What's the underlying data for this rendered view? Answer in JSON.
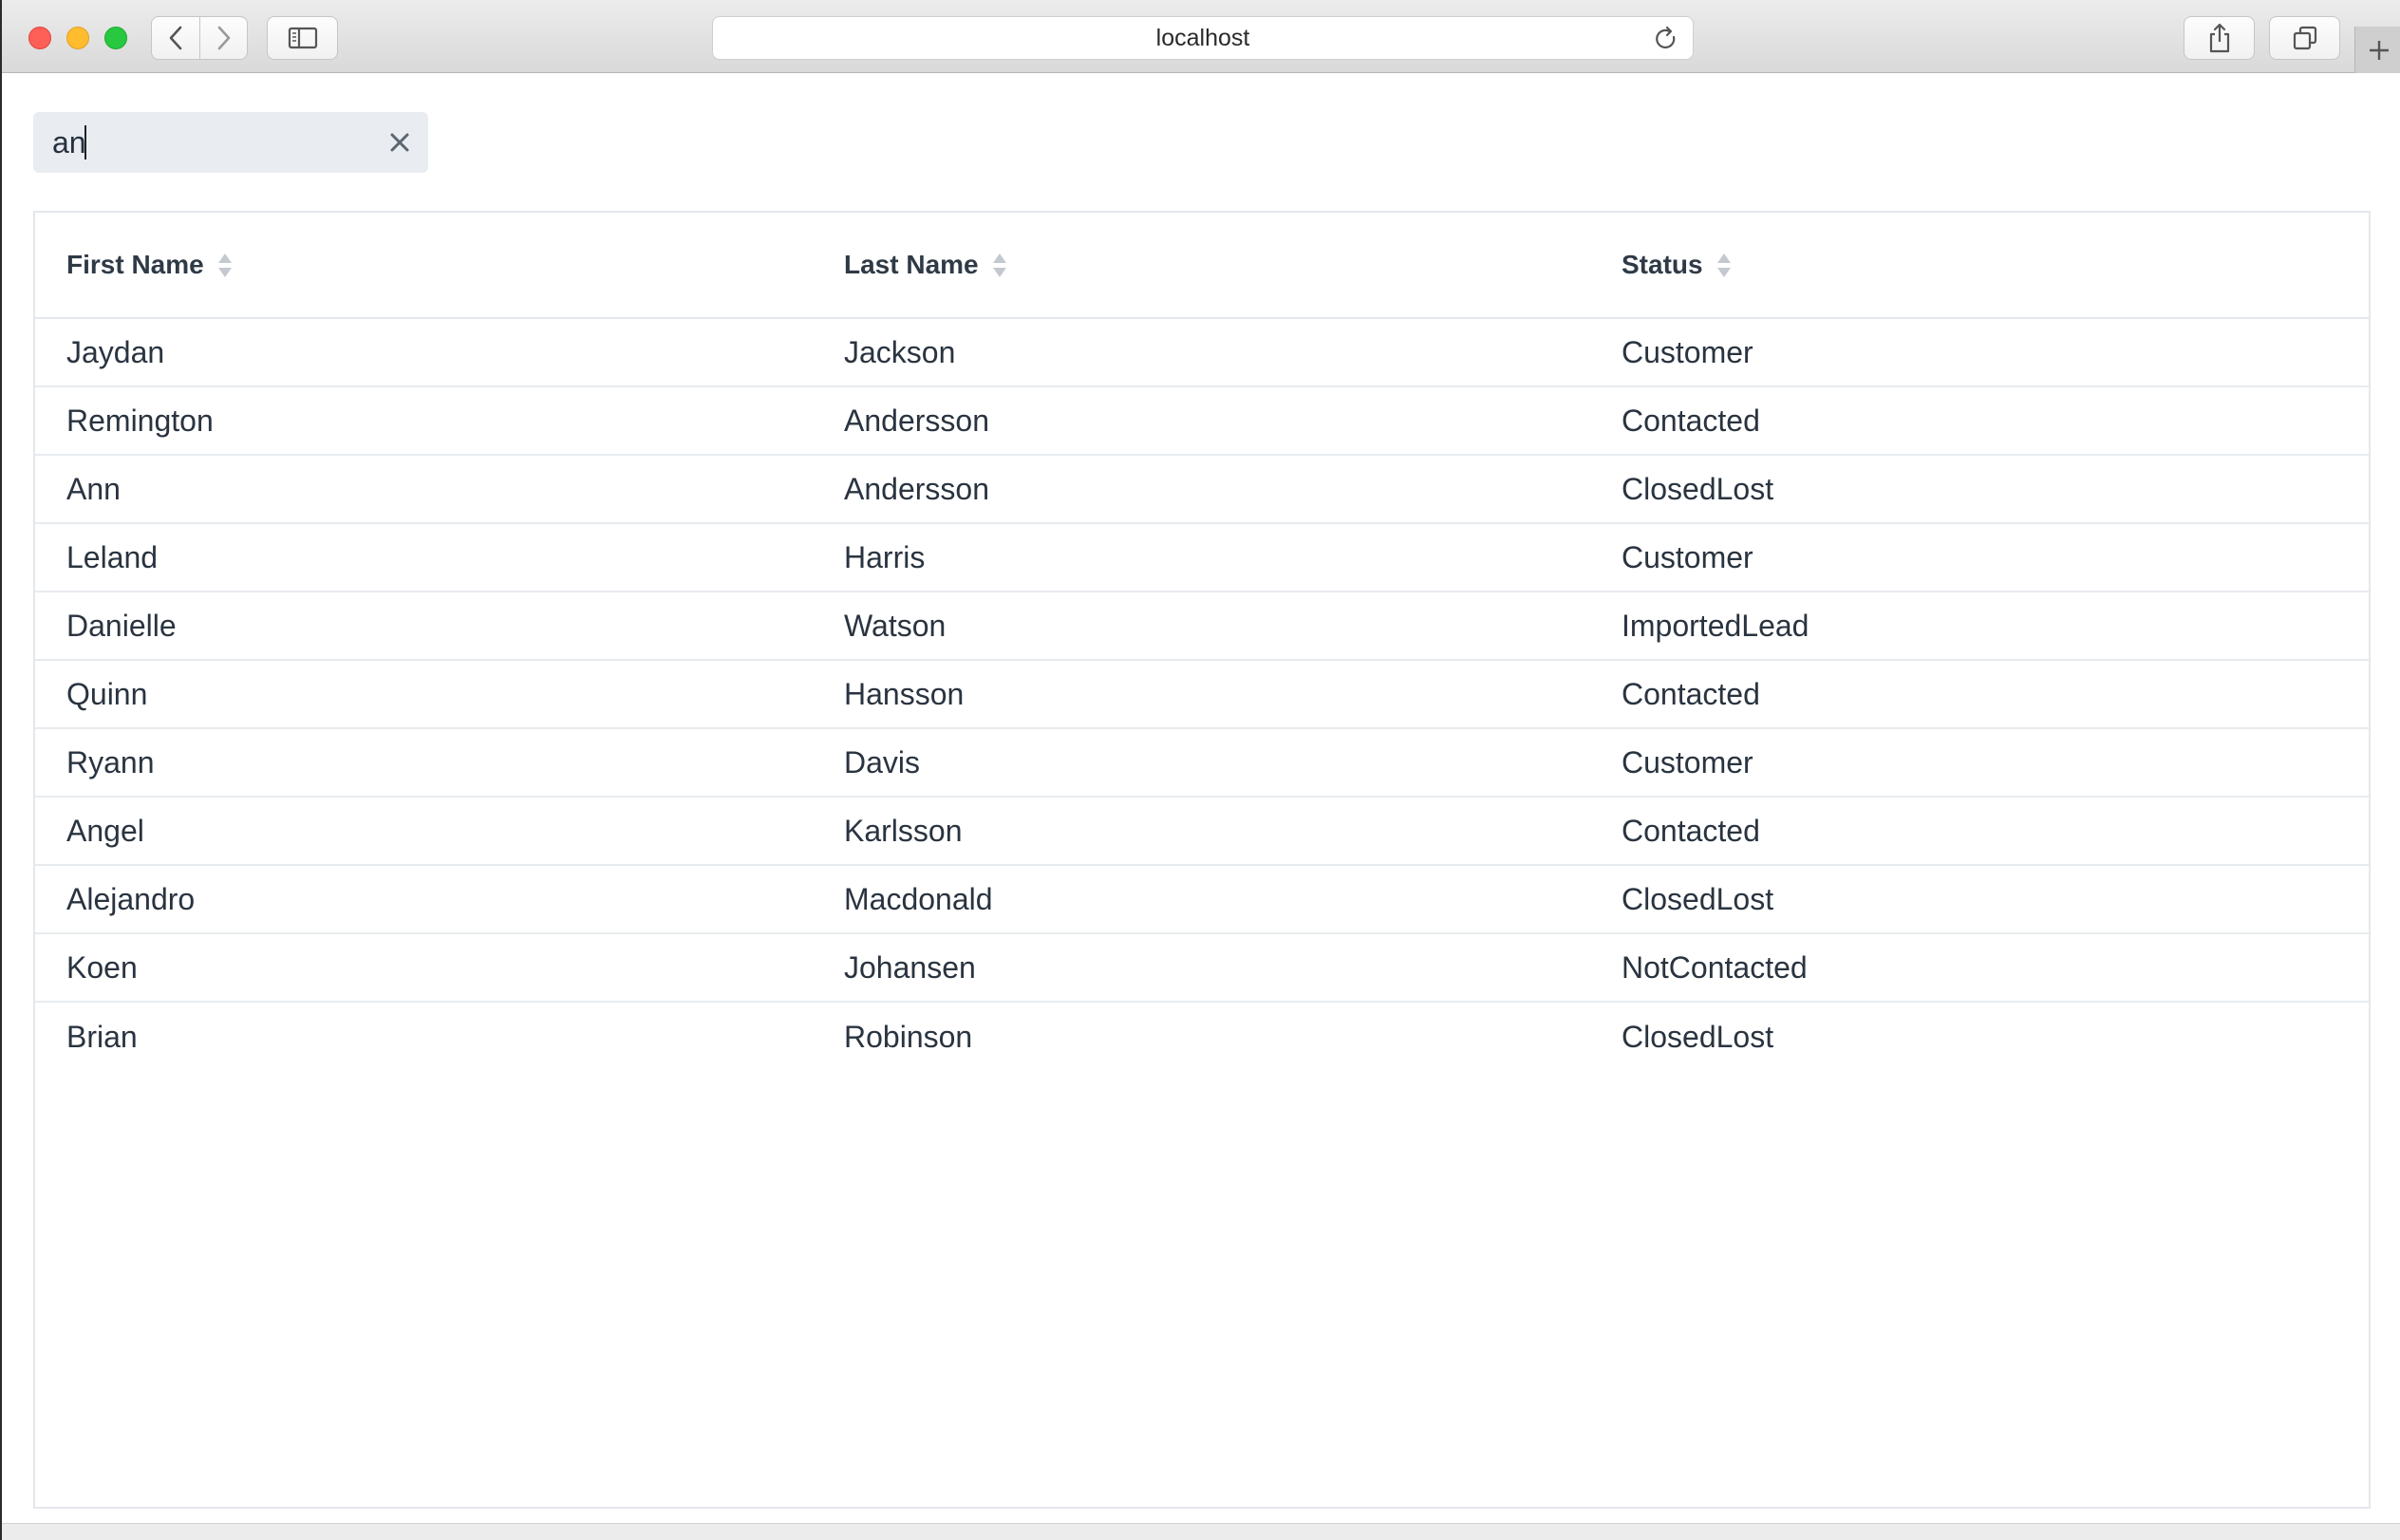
{
  "browser": {
    "url": "localhost",
    "icons": {
      "back": "chevron-left-icon",
      "forward": "chevron-right-icon",
      "sidebar": "sidebar-icon",
      "reload": "reload-icon",
      "share": "share-icon",
      "tabs": "tabs-overview-icon",
      "new_tab": "plus-icon"
    }
  },
  "search": {
    "value": "an",
    "clear_icon": "close-icon"
  },
  "table": {
    "headers": [
      "First Name",
      "Last Name",
      "Status"
    ],
    "rows": [
      [
        "Jaydan",
        "Jackson",
        "Customer"
      ],
      [
        "Remington",
        "Andersson",
        "Contacted"
      ],
      [
        "Ann",
        "Andersson",
        "ClosedLost"
      ],
      [
        "Leland",
        "Harris",
        "Customer"
      ],
      [
        "Danielle",
        "Watson",
        "ImportedLead"
      ],
      [
        "Quinn",
        "Hansson",
        "Contacted"
      ],
      [
        "Ryann",
        "Davis",
        "Customer"
      ],
      [
        "Angel",
        "Karlsson",
        "Contacted"
      ],
      [
        "Alejandro",
        "Macdonald",
        "ClosedLost"
      ],
      [
        "Koen",
        "Johansen",
        "NotContacted"
      ],
      [
        "Brian",
        "Robinson",
        "ClosedLost"
      ]
    ]
  },
  "colors": {
    "traffic_red": "#fe5f57",
    "traffic_yellow": "#febc2e",
    "traffic_green": "#28c840",
    "search_bg": "#e9edf1",
    "text": "#2a3440"
  }
}
